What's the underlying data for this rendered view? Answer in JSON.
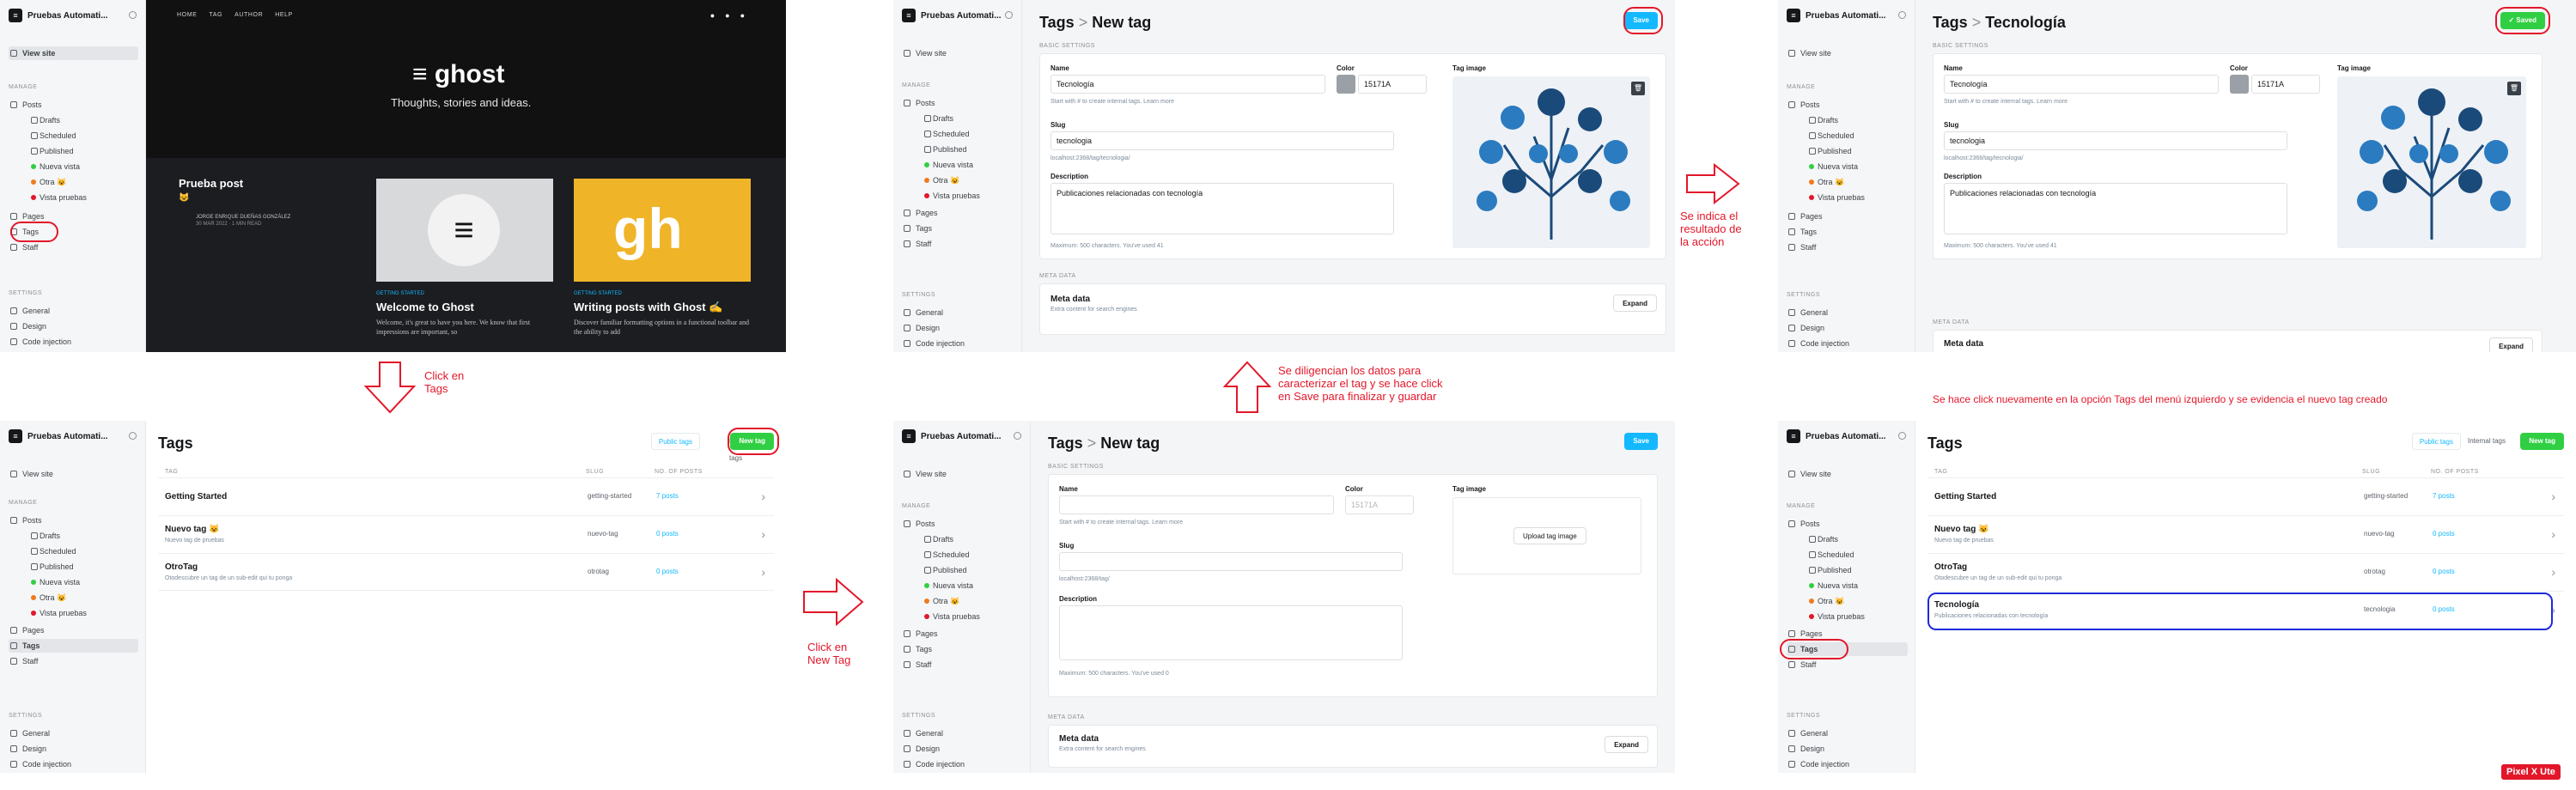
{
  "sidebar": {
    "site_name": "Pruebas Automati...",
    "view_site": "View site",
    "manage_label": "MANAGE",
    "posts": "Posts",
    "drafts": "Drafts",
    "scheduled": "Scheduled",
    "published": "Published",
    "nueva_vista": "Nueva vista",
    "otra": "Otra 😺",
    "vista_pruebas": "Vista pruebas",
    "pages": "Pages",
    "tags": "Tags",
    "staff": "Staff",
    "settings_label": "SETTINGS",
    "general": "General",
    "design": "Design",
    "code_injection": "Code injection"
  },
  "ghost_site": {
    "nav": [
      "HOME",
      "TAG",
      "AUTHOR",
      "HELP"
    ],
    "brand": "ghost",
    "tagline": "Thoughts, stories and ideas.",
    "post1_title": "Prueba post",
    "post1_author": "JORGE ENRIQUE DUEÑAS GONZÁLEZ",
    "post1_meta": "30 MAR 2022 · 1 MIN READ",
    "post2_kicker": "GETTING STARTED",
    "post2_title": "Welcome to Ghost",
    "post2_excerpt": "Welcome, it's great to have you here. We know that first impressions are important, so",
    "post3_kicker": "GETTING STARTED",
    "post3_title": "Writing posts with Ghost ✍️",
    "post3_excerpt": "Discover familiar formatting options in a functional toolbar and the ability to add",
    "post3_logo": "gh"
  },
  "new_tag": {
    "breadcrumb_root": "Tags",
    "breadcrumb_sep": ">",
    "title": "New tag",
    "save": "Save",
    "basic_settings": "BASIC SETTINGS",
    "name_label": "Name",
    "name_value": "Tecnología",
    "name_help": "Start with # to create internal tags. Learn more",
    "color_label": "Color",
    "color_value": "15171A",
    "slug_label": "Slug",
    "slug_value": "tecnologia",
    "slug_help": "localhost:2368/tag/tecnologia/",
    "desc_label": "Description",
    "desc_value": "Publicaciones relacionadas con tecnología",
    "desc_help": "Maximum: 500 characters. You've used 41",
    "image_label": "Tag image",
    "meta_head": "META DATA",
    "meta_title": "Meta data",
    "meta_sub": "Extra content for search engines",
    "expand": "Expand"
  },
  "saved_tag": {
    "title": "Tecnología",
    "saved": "✓ Saved",
    "desc_help": "Maximum: 500 characters. You've used 41"
  },
  "tags_list": {
    "title": "Tags",
    "public_tags": "Public tags",
    "internal_tags": "Internal tags",
    "new_tag": "New tag",
    "col_tag": "TAG",
    "col_slug": "SLUG",
    "col_posts": "NO. OF POSTS",
    "rows": [
      {
        "name": "Getting Started",
        "desc": "",
        "slug": "getting-started",
        "count": "7 posts"
      },
      {
        "name": "Nuevo tag 😺",
        "desc": "Nuevo tag de pruebas",
        "slug": "nuevo-tag",
        "count": "0 posts"
      },
      {
        "name": "OtroTag",
        "desc": "Otodescubre un tag de un sub-edit qui tu ponga",
        "slug": "otrotag",
        "count": "0 posts"
      },
      {
        "name": "Tecnología",
        "desc": "Publicaciones relacionadas con tecnología",
        "slug": "tecnologia",
        "count": "0 posts"
      }
    ]
  },
  "empty_tag": {
    "color_placeholder": "15171A",
    "upload": "Upload tag image",
    "desc_help": "Maximum: 500 characters. You've used 0",
    "slug_help": "localhost:2368/tag/"
  },
  "annotations": {
    "click_tags": "Click en\nTags",
    "click_new_tag": "Click en\nNew Tag",
    "fill_data": "Se diligencian los datos para\ncaracterizar el tag y se hace click\nen Save para finalizar y guardar",
    "result": "Se indica el\nresultado de\nla acción",
    "final": "Se hace click nuevamente en la opción Tags del menú izquierdo y se evidencia el nuevo tag creado"
  },
  "watermark": "Pixel X Ute",
  "colors": {
    "accent_red": "#e3172a",
    "ghost_blue": "#14b8ff",
    "ghost_green": "#30cf43",
    "highlight_blue": "#1f2ad9"
  }
}
